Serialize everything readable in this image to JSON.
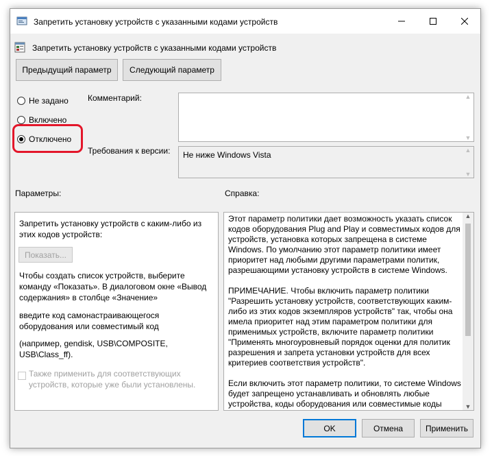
{
  "window": {
    "title": "Запретить установку устройств с указанными кодами устройств",
    "controls": {
      "minimize": "minimize-icon",
      "maximize": "maximize-icon",
      "close": "close-icon"
    }
  },
  "header": {
    "policy_name": "Запретить установку устройств с указанными кодами устройств",
    "prev_button": "Предыдущий параметр",
    "next_button": "Следующий параметр"
  },
  "state": {
    "options": [
      {
        "label": "Не задано",
        "checked": false
      },
      {
        "label": "Включено",
        "checked": false
      },
      {
        "label": "Отключено",
        "checked": true
      }
    ],
    "highlight_color": "#e3162a"
  },
  "comment": {
    "label": "Комментарий:",
    "value": ""
  },
  "version": {
    "label": "Требования к версии:",
    "value": "Не ниже Windows Vista"
  },
  "options_panel": {
    "label": "Параметры:",
    "intro": "Запретить установку устройств с каким-либо из этих кодов устройств:",
    "show_button": "Показать...",
    "text1": "Чтобы создать список устройств, выберите команду «Показать». В диалоговом окне «Вывод содержания» в столбце «Значение»",
    "text2": "введите код самонастраивающегося оборудования или совместимый код",
    "text3": "(например, gendisk, USB\\COMPOSITE, USB\\Class_ff).",
    "checkbox_label": "Также применить для соответствующих устройств, которые уже были установлены.",
    "checkbox_checked": false
  },
  "help_panel": {
    "label": "Справка:",
    "paragraphs": [
      "Этот параметр политики дает возможность указать список кодов оборудования Plug and Play и совместимых кодов для устройств, установка которых запрещена в системе Windows. По умолчанию этот параметр политики имеет приоритет над любыми другими параметрами политик, разрешающими установку устройств в системе Windows.",
      "ПРИМЕЧАНИЕ. Чтобы включить параметр политики \"Разрешить установку устройств, соответствующих каким-либо из этих кодов экземпляров устройств\" так, чтобы она имела приоритет над этим параметром политики для применимых устройств, включите параметр политики \"Применять многоуровневый порядок оценки для политик разрешения и запрета установки устройств для всех критериев соответствия устройств\".",
      "Если включить этот параметр политики, то системе Windows будет запрещено устанавливать и обновлять любые устройства, коды оборудования или совместимые коды"
    ]
  },
  "footer": {
    "ok": "OK",
    "cancel": "Отмена",
    "apply": "Применить"
  }
}
